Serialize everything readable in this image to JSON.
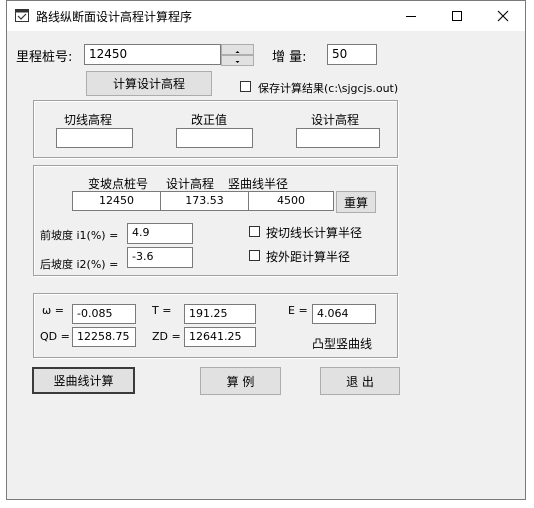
{
  "window": {
    "title": "路线纵断面设计高程计算程序",
    "minimize_icon": "minimize-icon",
    "maximize_icon": "maximize-icon",
    "close_icon": "close-icon"
  },
  "top": {
    "station_label": "里程桩号:",
    "station_value": "12450",
    "increment_label": "增 量:",
    "increment_value": "50",
    "calc_button": "计算设计高程",
    "save_checkbox_label": "保存计算结果(c:\\sjgcjs.out)",
    "save_checked": false
  },
  "elevation_group": {
    "tangent_label": "切线高程",
    "tangent_value": "",
    "correction_label": "改正值",
    "correction_value": "",
    "design_label": "设计高程",
    "design_value": ""
  },
  "curve_group": {
    "header_station": "变坡点桩号",
    "header_elevation": "设计高程",
    "header_radius": "竖曲线半径",
    "station": "12450",
    "elevation": "173.53",
    "radius": "4500",
    "recalc_button": "重算",
    "front_grade_label": "前坡度 i1(%) =",
    "front_grade_value": "4.9",
    "back_grade_label": "后坡度 i2(%) =",
    "back_grade_value": "-3.6",
    "by_tangent_label": "按切线长计算半径",
    "by_external_label": "按外距计算半径"
  },
  "results_group": {
    "omega_label": "ω =",
    "omega_value": "-0.085",
    "t_label": "T =",
    "t_value": "191.25",
    "e_label": "E =",
    "e_value": "4.064",
    "qd_label": "QD =",
    "qd_value": "12258.75",
    "zd_label": "ZD =",
    "zd_value": "12641.25",
    "curve_type": "凸型竖曲线"
  },
  "buttons": {
    "vertical_curve": "竖曲线计算",
    "example": "算 例",
    "exit": "退 出"
  }
}
